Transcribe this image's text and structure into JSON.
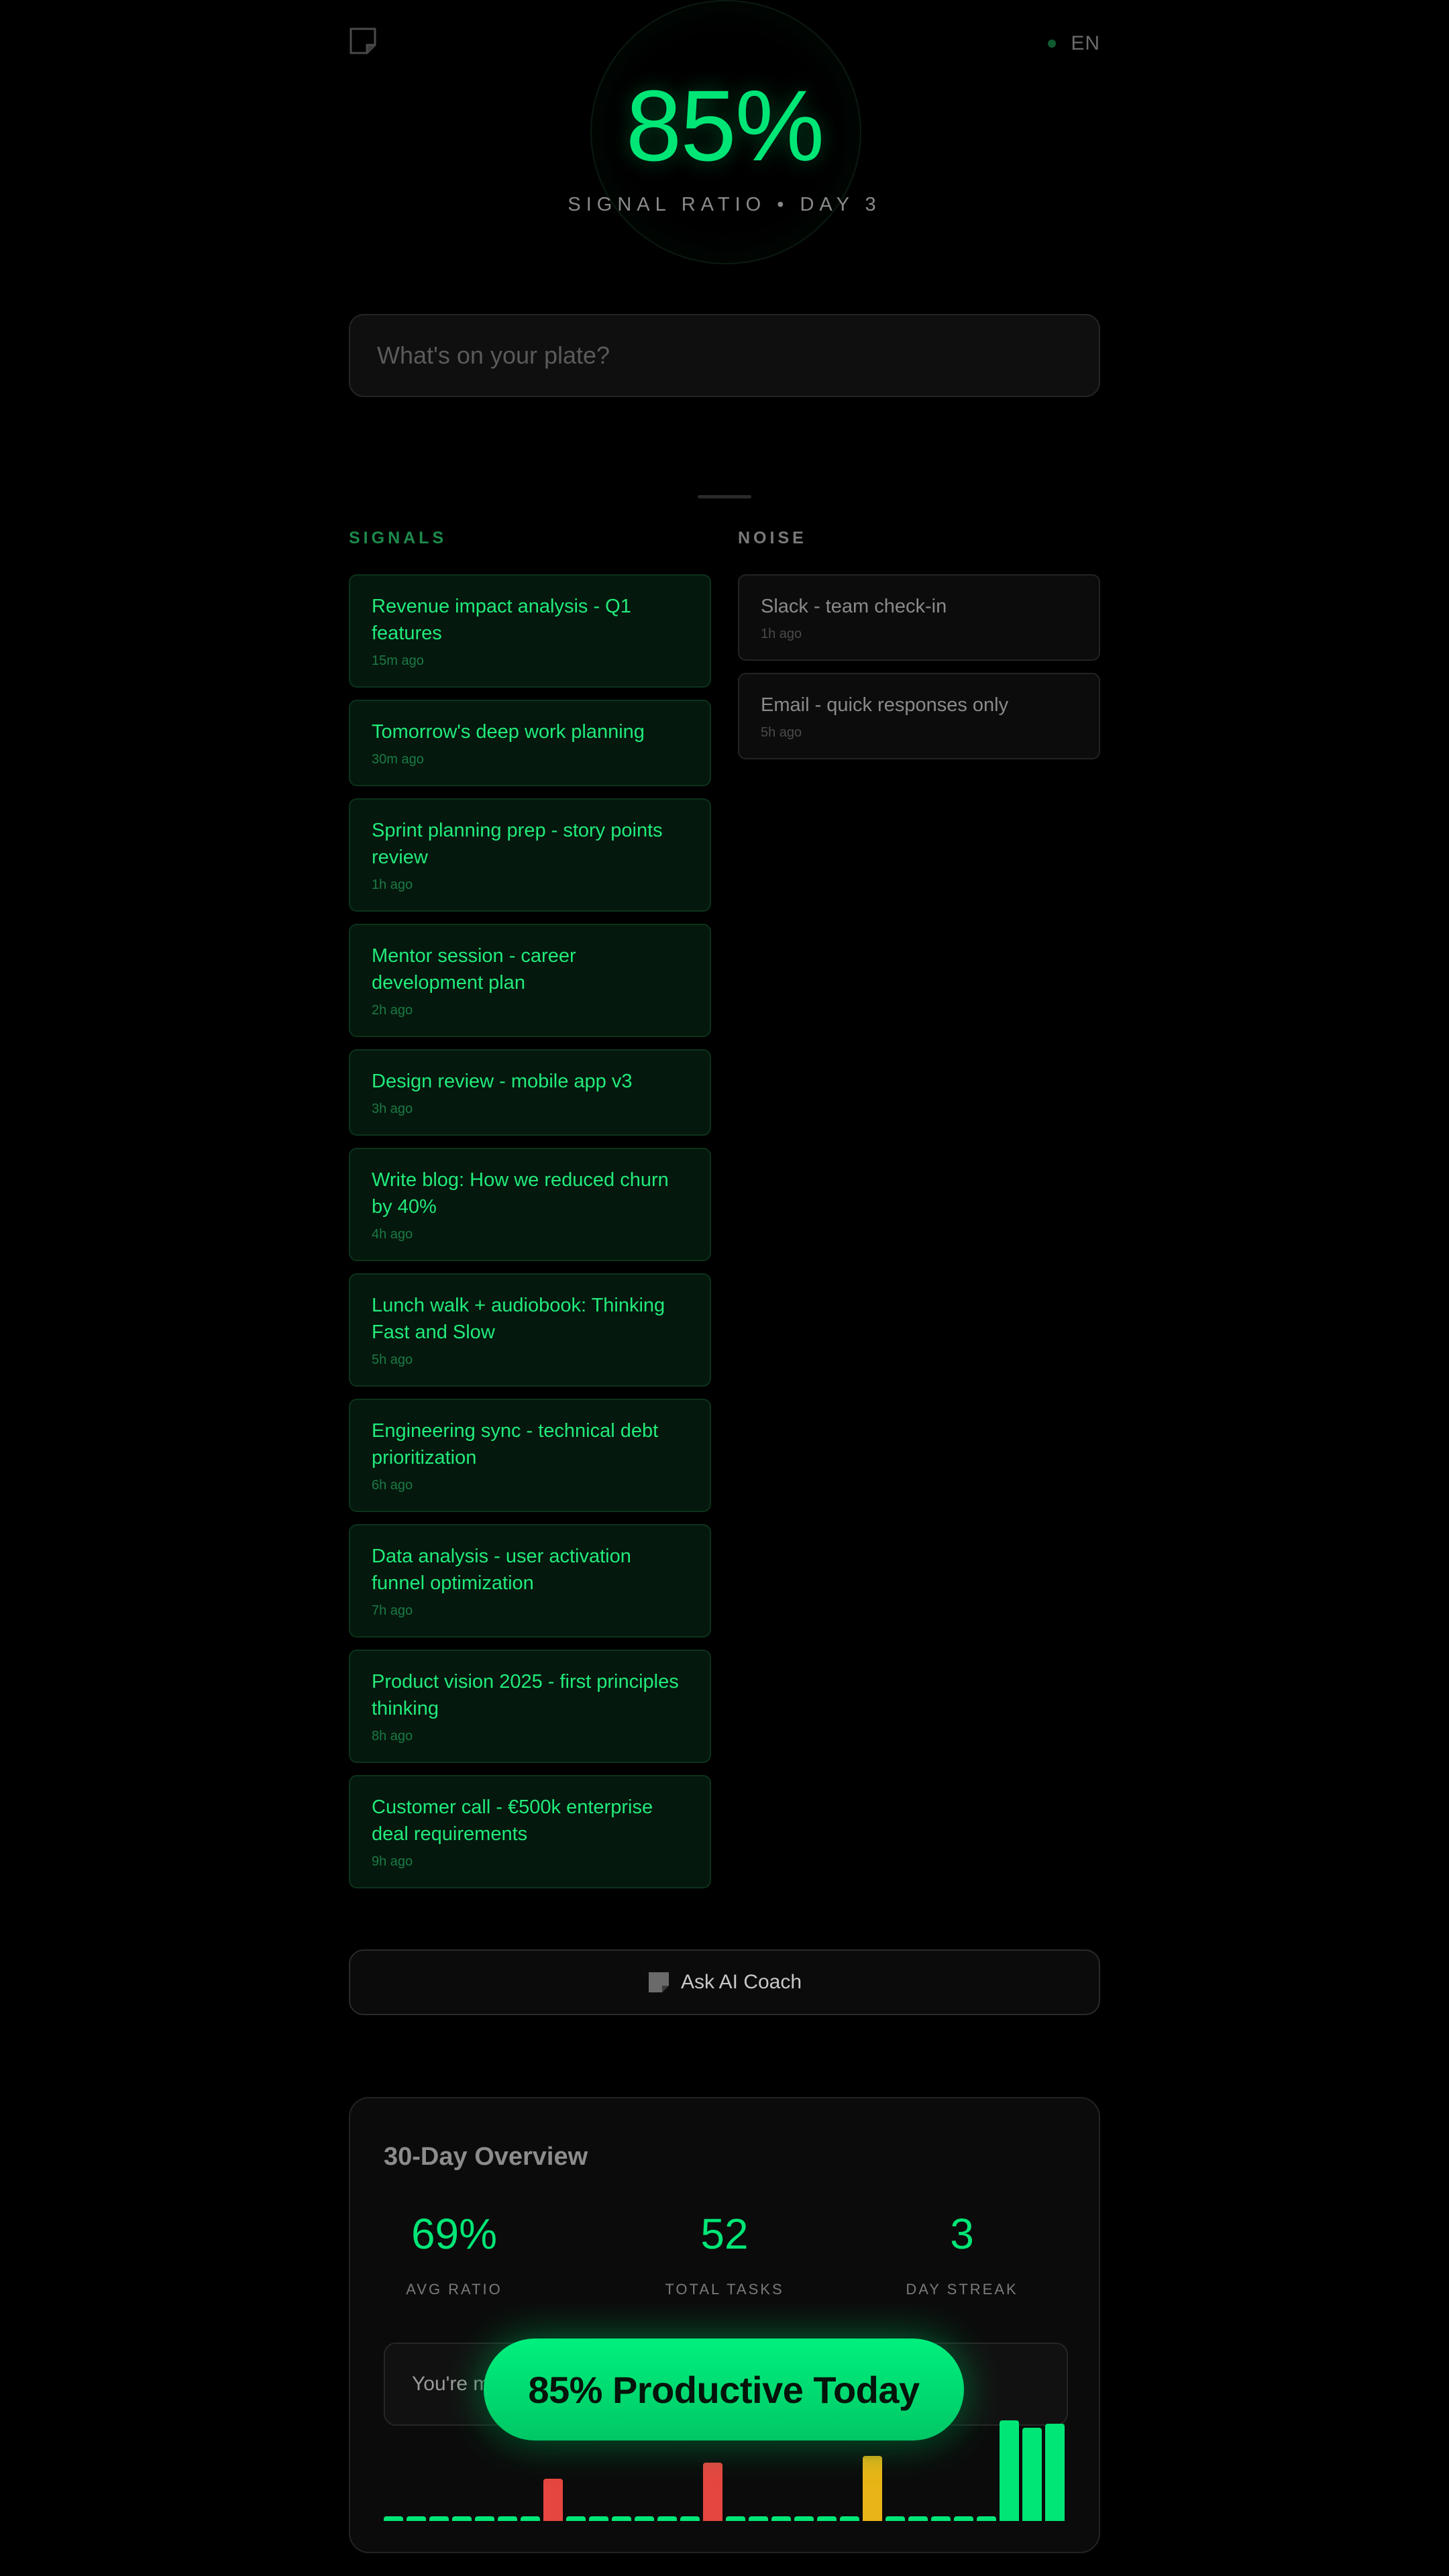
{
  "header": {
    "language": "EN",
    "ratio_value": "85%",
    "ratio_subtitle": "SIGNAL RATIO • DAY 3"
  },
  "input": {
    "placeholder": "What's on your plate?",
    "value": ""
  },
  "signals": {
    "title": "SIGNALS",
    "items": [
      {
        "text": "Revenue impact analysis - Q1 features",
        "time": "15m ago"
      },
      {
        "text": "Tomorrow's deep work planning",
        "time": "30m ago"
      },
      {
        "text": "Sprint planning prep - story points review",
        "time": "1h ago"
      },
      {
        "text": "Mentor session - career development plan",
        "time": "2h ago"
      },
      {
        "text": "Design review - mobile app v3",
        "time": "3h ago"
      },
      {
        "text": "Write blog: How we reduced churn by 40%",
        "time": "4h ago"
      },
      {
        "text": "Lunch walk + audiobook: Thinking Fast and Slow",
        "time": "5h ago"
      },
      {
        "text": "Engineering sync - technical debt prioritization",
        "time": "6h ago"
      },
      {
        "text": "Data analysis - user activation funnel optimization",
        "time": "7h ago"
      },
      {
        "text": "Product vision 2025 - first principles thinking",
        "time": "8h ago"
      },
      {
        "text": "Customer call - €500k enterprise deal requirements",
        "time": "9h ago"
      }
    ]
  },
  "noise": {
    "title": "NOISE",
    "items": [
      {
        "text": "Slack - team check-in",
        "time": "1h ago"
      },
      {
        "text": "Email - quick responses only",
        "time": "5h ago"
      }
    ]
  },
  "coach": {
    "label": "Ask AI Coach"
  },
  "overview": {
    "title": "30-Day Overview",
    "stats": [
      {
        "value": "69%",
        "label": "AVG RATIO"
      },
      {
        "value": "52",
        "label": "TOTAL TASKS"
      },
      {
        "value": "3",
        "label": "DAY STREAK"
      }
    ],
    "insight_text": "You're m",
    "daily_values": [
      0.05,
      0.05,
      0.05,
      0.05,
      0.05,
      0.05,
      0.05,
      0.42,
      0.05,
      0.05,
      0.05,
      0.05,
      0.05,
      0.05,
      0.58,
      0.05,
      0.05,
      0.05,
      0.05,
      0.05,
      0.05,
      0.65,
      0.05,
      0.05,
      0.05,
      0.05,
      0.05,
      1.0,
      0.93,
      0.97
    ],
    "bar_colors": {
      "good": "#00e676",
      "bad": "#e5463f",
      "mid": "#e8b417"
    }
  },
  "celebration": {
    "label": "85% Productive Today"
  },
  "colors": {
    "accent": "#00e676",
    "background": "#000000"
  }
}
